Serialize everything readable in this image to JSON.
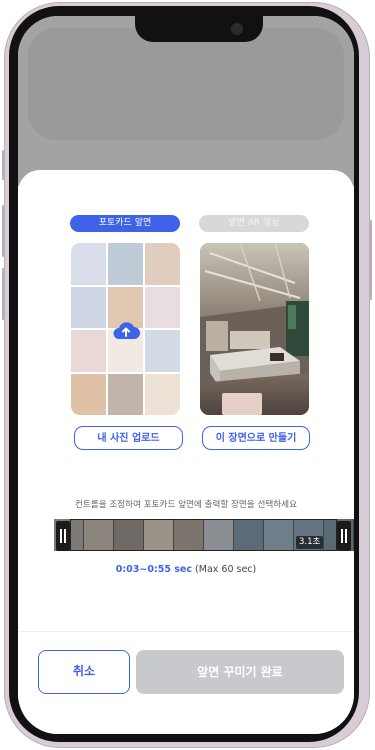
{
  "tabs": {
    "front": "포토카드 앞면",
    "back": "앞면 AR 영상"
  },
  "cards": {
    "front_upload_icon": "cloud-upload-icon",
    "back_preview": "cafe-scene-image"
  },
  "buttons": {
    "upload": "내 사진 업로드",
    "make_from_scene": "이 장면으로 만들기",
    "cancel": "취소",
    "done": "앞면 꾸미기 완료"
  },
  "hint": "컨트롤을 조정하여 포토카드 앞면에 출력할 장면을 선택하세요",
  "timeline": {
    "duration_badge": "3.1초",
    "range_text": "0:03~0:55 sec",
    "max_text": " (Max 60 sec)"
  },
  "colors": {
    "accent": "#3f63e8",
    "disabled": "#c7c9cd",
    "tab_inactive": "#d6d8dc"
  }
}
